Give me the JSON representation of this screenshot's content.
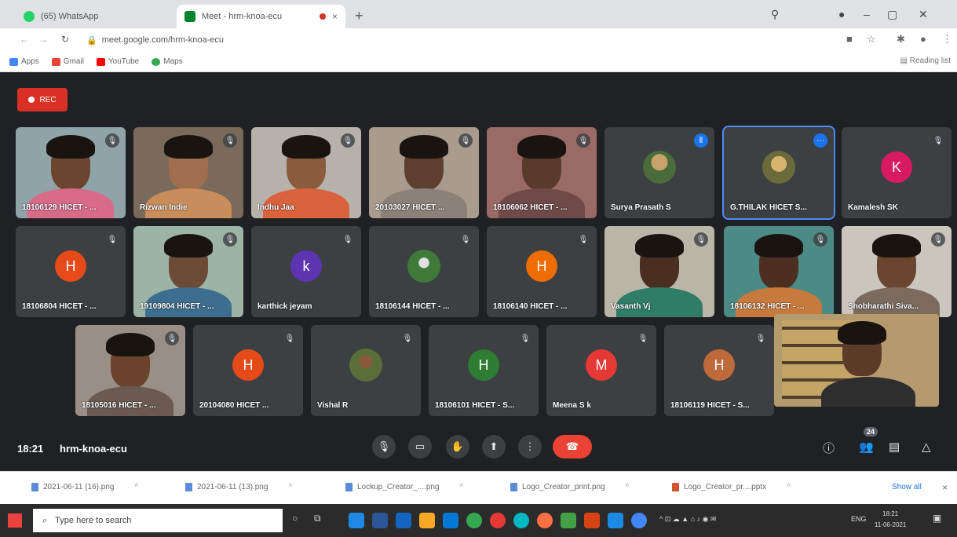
{
  "browser": {
    "tabs": [
      {
        "title": "(65) WhatsApp",
        "close": "×",
        "favicon_color": "#25d366"
      },
      {
        "title": "Meet - hrm-knoa-ecu",
        "close": "×",
        "favicon_color": "#00832d"
      }
    ],
    "new_tab": "+",
    "address": "meet.google.com/hrm-knoa-ecu",
    "bookmarks": [
      {
        "label": "Apps",
        "icon_color": "#4285f4"
      },
      {
        "label": "Gmail",
        "icon_color": "#ea4335"
      },
      {
        "label": "YouTube",
        "icon_color": "#ff0000"
      },
      {
        "label": "Maps",
        "icon_color": "#34a853"
      }
    ],
    "reading_list": "Reading list"
  },
  "meet": {
    "rec_label": "REC",
    "tiles": [
      {
        "name": "18106129 HICET - ..."
      },
      {
        "name": "Rizwan Indie"
      },
      {
        "name": "Indhu Jaa"
      },
      {
        "name": "20103027 HICET ..."
      },
      {
        "name": "18106062 HICET - ..."
      },
      {
        "name": "Surya Prasath S"
      },
      {
        "name": "G.THILAK HICET S..."
      },
      {
        "name": "Kamalesh SK",
        "initial": "K",
        "color": "#d81b60"
      },
      {
        "name": "18106804 HICET - ...",
        "initial": "H",
        "color": "#e64a19"
      },
      {
        "name": "19109804 HICET - ..."
      },
      {
        "name": "karthick jeyam",
        "initial": "k",
        "color": "#5e35b1"
      },
      {
        "name": "18106144 HICET - ..."
      },
      {
        "name": "18106140 HICET - ...",
        "initial": "H",
        "color": "#ef6c00"
      },
      {
        "name": "Vasanth Vj"
      },
      {
        "name": "18106132 HICET - ..."
      },
      {
        "name": "Shobharathi Siva..."
      },
      {
        "name": "18105016 HICET - ..."
      },
      {
        "name": "20104080 HICET ...",
        "initial": "H",
        "color": "#e64a19"
      },
      {
        "name": "Vishal R"
      },
      {
        "name": "18106101 HICET - S...",
        "initial": "H",
        "color": "#2e7d32"
      },
      {
        "name": "Meena S k",
        "initial": "M",
        "color": "#e53935"
      },
      {
        "name": "18106119 HICET - S...",
        "initial": "H",
        "color": "#bf6a3a"
      }
    ],
    "time": "18:21",
    "meeting_code": "hrm-knoa-ecu",
    "participant_count": "24"
  },
  "downloads": {
    "items": [
      {
        "label": "2021-06-11 (16).png"
      },
      {
        "label": "2021-06-11 (13).png"
      },
      {
        "label": "Lockup_Creator_....png"
      },
      {
        "label": "Logo_Creator_print.png"
      },
      {
        "label": "Logo_Creator_pr....pptx"
      }
    ],
    "show_all": "Show all",
    "close": "×"
  },
  "taskbar": {
    "search_placeholder": "Type here to search",
    "lang": "ENG",
    "clock_time": "18:21",
    "clock_date": "11-06-2021"
  }
}
